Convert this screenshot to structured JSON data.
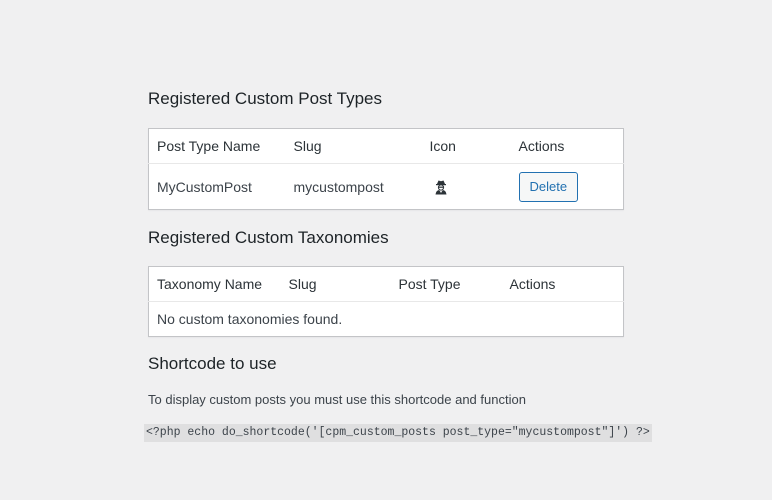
{
  "post_types": {
    "heading": "Registered Custom Post Types",
    "columns": [
      "Post Type Name",
      "Slug",
      "Icon",
      "Actions"
    ],
    "rows": [
      {
        "name": "MyCustomPost",
        "slug": "mycustompost",
        "icon": "user-secret-icon",
        "action_label": "Delete"
      }
    ]
  },
  "taxonomies": {
    "heading": "Registered Custom Taxonomies",
    "columns": [
      "Taxonomy Name",
      "Slug",
      "Post Type",
      "Actions"
    ],
    "empty_message": "No custom taxonomies found."
  },
  "shortcode": {
    "heading": "Shortcode to use",
    "description": "To display custom posts you must use this shortcode and function",
    "code": "<?php echo do_shortcode('[cpm_custom_posts post_type=\"mycustompost\"]') ?>"
  },
  "colors": {
    "background": "#f0f0f1",
    "accent": "#2271b1",
    "border": "#c3c4c7"
  }
}
